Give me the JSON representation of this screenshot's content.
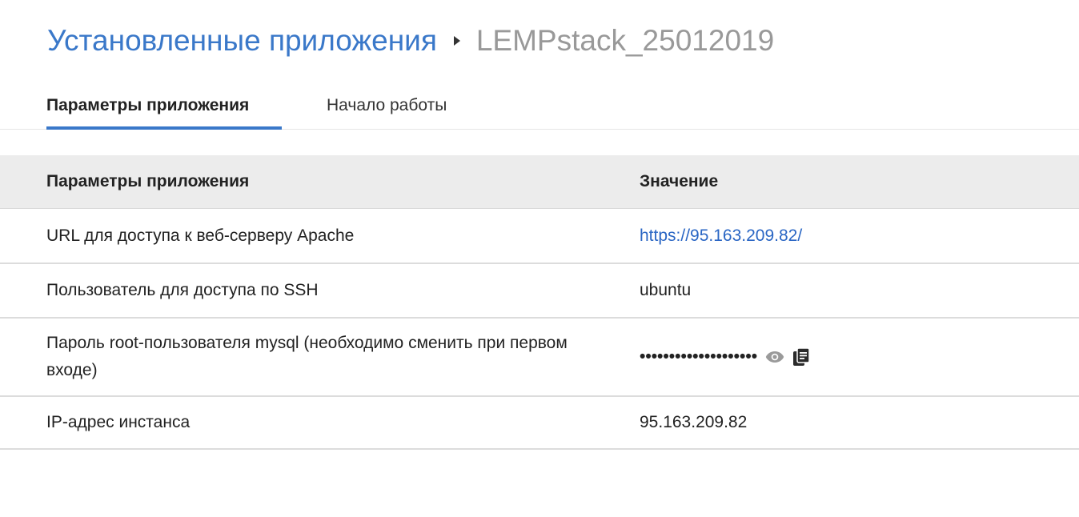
{
  "breadcrumb": {
    "parent": "Установленные приложения",
    "current": "LEMPstack_25012019"
  },
  "tabs": [
    {
      "label": "Параметры приложения",
      "active": true
    },
    {
      "label": "Начало работы",
      "active": false
    }
  ],
  "table": {
    "headers": [
      "Параметры приложения",
      "Значение"
    ],
    "rows": [
      {
        "param": "URL для доступа к веб-серверу Apache",
        "value": "https://95.163.209.82/"
      },
      {
        "param": "Пользователь для доступа по SSH",
        "value": "ubuntu"
      },
      {
        "param": "Пароль root-пользователя mysql (необходимо сменить при первом входе)",
        "value": "••••••••••••••••••••"
      },
      {
        "param": "IP-адрес инстанса",
        "value": "95.163.209.82"
      }
    ]
  },
  "icons": {
    "reveal": "eye-icon",
    "copy": "copy-icon"
  },
  "colors": {
    "accent": "#3a78c9",
    "link": "#2a66c4",
    "muted": "#999999",
    "header_bg": "#ececec"
  }
}
